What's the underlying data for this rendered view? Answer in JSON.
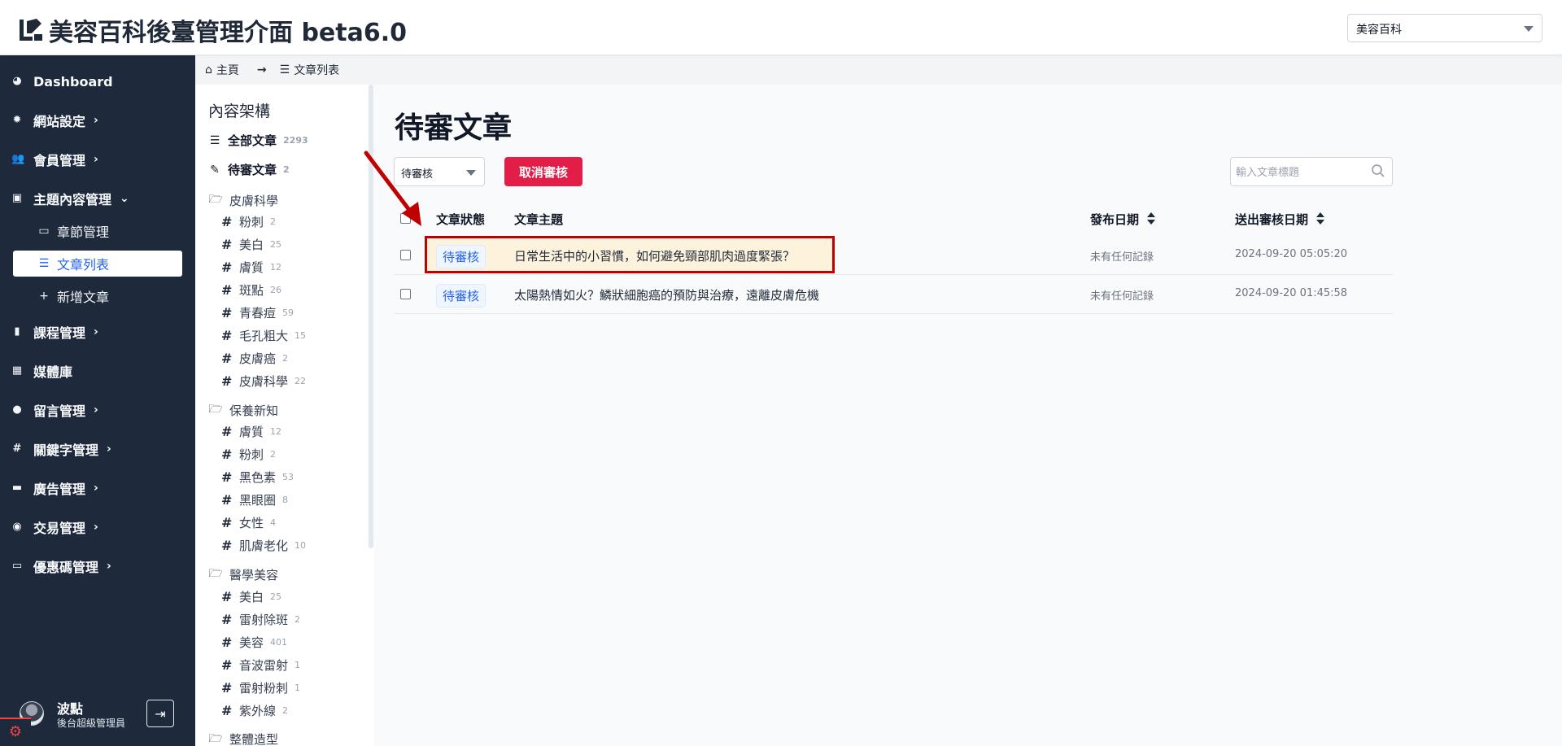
{
  "header": {
    "title": "美容百科後臺管理介面 beta6.0",
    "site_select": {
      "value": "美容百科"
    }
  },
  "sidebar": {
    "items": [
      {
        "label": "Dashboard",
        "icon": "dashboard-icon",
        "glyph": "◕",
        "chevron": false
      },
      {
        "label": "網站設定",
        "icon": "gear-icon",
        "glyph": "✹",
        "chevron": true
      },
      {
        "label": "會員管理",
        "icon": "users-icon",
        "glyph": "👥",
        "chevron": true
      },
      {
        "label": "主題內容管理",
        "icon": "archive-icon",
        "glyph": "▣",
        "chevron": true,
        "expanded": true
      },
      {
        "label": "課程管理",
        "icon": "book-icon",
        "glyph": "▮",
        "chevron": true
      },
      {
        "label": "媒體庫",
        "icon": "images-icon",
        "glyph": "▦",
        "chevron": false
      },
      {
        "label": "留言管理",
        "icon": "comment-icon",
        "glyph": "●",
        "chevron": true
      },
      {
        "label": "關鍵字管理",
        "icon": "hashtag-icon",
        "glyph": "#",
        "chevron": true
      },
      {
        "label": "廣告管理",
        "icon": "ad-icon",
        "glyph": "▬",
        "chevron": true
      },
      {
        "label": "交易管理",
        "icon": "money-icon",
        "glyph": "◉",
        "chevron": true
      },
      {
        "label": "優惠碼管理",
        "icon": "ticket-icon",
        "glyph": "▭",
        "chevron": true
      }
    ],
    "sub_items": [
      {
        "label": "章節管理",
        "icon": "server-icon",
        "glyph": "▭"
      },
      {
        "label": "文章列表",
        "icon": "list-icon",
        "glyph": "☰",
        "active": true
      },
      {
        "label": "新增文章",
        "icon": "plus-icon",
        "glyph": "+"
      }
    ],
    "user": {
      "name": "波點",
      "role": "後台超級管理員"
    }
  },
  "breadcrumb": {
    "home": "主頁",
    "current": "文章列表"
  },
  "tree": {
    "title": "內容架構",
    "top": [
      {
        "label": "全部文章",
        "count": "2293",
        "icon": "list-icon",
        "glyph": "☰"
      },
      {
        "label": "待審文章",
        "count": "2",
        "icon": "edit-icon",
        "glyph": "✎"
      }
    ],
    "groups": [
      {
        "name": "皮膚科學",
        "tags": [
          {
            "label": "粉刺",
            "count": "2"
          },
          {
            "label": "美白",
            "count": "25"
          },
          {
            "label": "膚質",
            "count": "12"
          },
          {
            "label": "斑點",
            "count": "26"
          },
          {
            "label": "青春痘",
            "count": "59"
          },
          {
            "label": "毛孔粗大",
            "count": "15"
          },
          {
            "label": "皮膚癌",
            "count": "2"
          },
          {
            "label": "皮膚科學",
            "count": "22"
          }
        ]
      },
      {
        "name": "保養新知",
        "tags": [
          {
            "label": "膚質",
            "count": "12"
          },
          {
            "label": "粉刺",
            "count": "2"
          },
          {
            "label": "黑色素",
            "count": "53"
          },
          {
            "label": "黑眼圈",
            "count": "8"
          },
          {
            "label": "女性",
            "count": "4"
          },
          {
            "label": "肌膚老化",
            "count": "10"
          }
        ]
      },
      {
        "name": "醫學美容",
        "tags": [
          {
            "label": "美白",
            "count": "25"
          },
          {
            "label": "雷射除斑",
            "count": "2"
          },
          {
            "label": "美容",
            "count": "401"
          },
          {
            "label": "音波雷射",
            "count": "1"
          },
          {
            "label": "雷射粉刺",
            "count": "1"
          },
          {
            "label": "紫外線",
            "count": "2"
          }
        ]
      },
      {
        "name": "整體造型",
        "tags": []
      }
    ]
  },
  "main": {
    "title": "待審文章",
    "status_select": {
      "value": "待審核"
    },
    "cancel_button": "取消審核",
    "search": {
      "placeholder": "輸入文章標題",
      "value": ""
    },
    "columns": {
      "status": "文章狀態",
      "subject": "文章主題",
      "publish_date": "發布日期",
      "submit_date": "送出審核日期"
    },
    "rows": [
      {
        "status": "待審核",
        "subject": "日常生活中的小習慣，如何避免頸部肌肉過度緊張？",
        "publish_date": "未有任何記錄",
        "submit_date": "2024-09-20 05:05:20",
        "highlighted": true
      },
      {
        "status": "待審核",
        "subject": "太陽熱情如火？鱗狀細胞癌的預防與治療，遠離皮膚危機",
        "publish_date": "未有任何記錄",
        "submit_date": "2024-09-20 01:45:58",
        "highlighted": false
      }
    ]
  },
  "colors": {
    "sidebar_bg": "#1e293b",
    "accent": "#2563eb",
    "danger": "#e11d48",
    "highlight_border": "#c00000",
    "highlight_bg": "#fdf2dc"
  }
}
